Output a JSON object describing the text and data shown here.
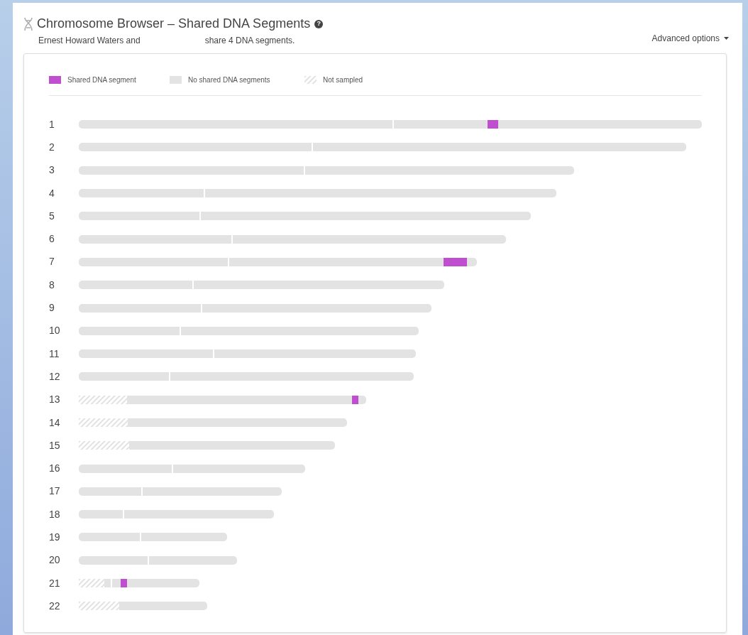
{
  "header": {
    "title": "Chromosome Browser – Shared DNA Segments",
    "help_icon": "?",
    "subtitle_start": "Ernest Howard Waters and",
    "subtitle_end": "share 4 DNA segments.",
    "advanced_options": "Advanced options"
  },
  "legend": [
    {
      "kind": "shared",
      "label": "Shared DNA segment"
    },
    {
      "kind": "none",
      "label": "No shared DNA segments"
    },
    {
      "kind": "not_sampled",
      "label": "Not sampled"
    }
  ],
  "chromosomes": [
    {
      "label": "1",
      "shared_segment": true,
      "not_sampled": false
    },
    {
      "label": "2",
      "shared_segment": false,
      "not_sampled": false
    },
    {
      "label": "3",
      "shared_segment": false,
      "not_sampled": false
    },
    {
      "label": "4",
      "shared_segment": false,
      "not_sampled": false
    },
    {
      "label": "5",
      "shared_segment": false,
      "not_sampled": false
    },
    {
      "label": "6",
      "shared_segment": false,
      "not_sampled": false
    },
    {
      "label": "7",
      "shared_segment": true,
      "not_sampled": false
    },
    {
      "label": "8",
      "shared_segment": false,
      "not_sampled": false
    },
    {
      "label": "9",
      "shared_segment": false,
      "not_sampled": false
    },
    {
      "label": "10",
      "shared_segment": false,
      "not_sampled": false
    },
    {
      "label": "11",
      "shared_segment": false,
      "not_sampled": false
    },
    {
      "label": "12",
      "shared_segment": false,
      "not_sampled": false
    },
    {
      "label": "13",
      "shared_segment": true,
      "not_sampled": true
    },
    {
      "label": "14",
      "shared_segment": false,
      "not_sampled": true
    },
    {
      "label": "15",
      "shared_segment": false,
      "not_sampled": true
    },
    {
      "label": "16",
      "shared_segment": false,
      "not_sampled": false
    },
    {
      "label": "17",
      "shared_segment": false,
      "not_sampled": false
    },
    {
      "label": "18",
      "shared_segment": false,
      "not_sampled": false
    },
    {
      "label": "19",
      "shared_segment": false,
      "not_sampled": false
    },
    {
      "label": "20",
      "shared_segment": false,
      "not_sampled": false
    },
    {
      "label": "21",
      "shared_segment": true,
      "not_sampled": true
    },
    {
      "label": "22",
      "shared_segment": false,
      "not_sampled": true
    }
  ]
}
